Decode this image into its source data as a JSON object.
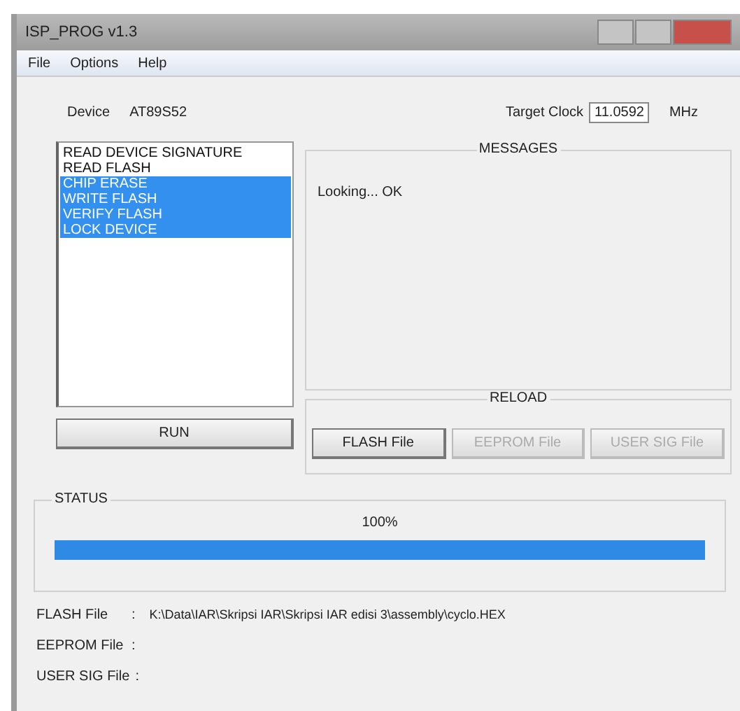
{
  "window": {
    "title": "ISP_PROG v1.3"
  },
  "menu": [
    "File",
    "Options",
    "Help"
  ],
  "device": {
    "label": "Device",
    "value": "AT89S52"
  },
  "clock": {
    "label": "Target Clock",
    "value": "11.0592",
    "unit": "MHz"
  },
  "operations": [
    {
      "label": "READ DEVICE SIGNATURE",
      "selected": false
    },
    {
      "label": "READ FLASH",
      "selected": false
    },
    {
      "label": "CHIP ERASE",
      "selected": true
    },
    {
      "label": "WRITE FLASH",
      "selected": true
    },
    {
      "label": "VERIFY FLASH",
      "selected": true
    },
    {
      "label": "LOCK DEVICE",
      "selected": true
    }
  ],
  "run_button": "RUN",
  "messages": {
    "title": "MESSAGES",
    "text": "Looking... OK"
  },
  "reload": {
    "title": "RELOAD",
    "buttons": [
      {
        "label": "FLASH File",
        "disabled": false
      },
      {
        "label": "EEPROM File",
        "disabled": true
      },
      {
        "label": "USER SIG File",
        "disabled": true
      }
    ]
  },
  "status": {
    "title": "STATUS",
    "reading": "100%",
    "level": 1
  },
  "files": [
    {
      "label": "FLASH File",
      "separator": ":",
      "value": "K:\\Data\\IAR\\Skripsi IAR\\Skripsi IAR edisi 3\\assembly\\cyclo.HEX"
    },
    {
      "label": "EEPROM File",
      "separator": ":"
    },
    {
      "label": "USER SIG File",
      "separator": ":"
    }
  ]
}
